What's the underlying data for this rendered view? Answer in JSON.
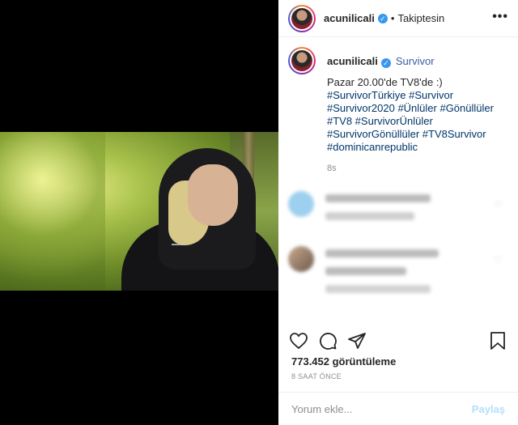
{
  "post": {
    "username": "acunilicali",
    "follow_state": "Takiptesin",
    "location": "Survivor",
    "caption_text": "Pazar 20.00'de TV8'de :)",
    "hashtags": "#SurvivorTürkiye #Survivor #Survivor2020 #Ünlüler #Gönüllüler #TV8 #SurvivorÜnlüler #SurvivorGönüllüler #TV8Survivor #dominicanrepublic",
    "caption_time": "8s",
    "views": "773.452 görüntüleme",
    "posted_ago": "8 SAAT ÖNCE",
    "comment_placeholder": "Yorum ekle...",
    "post_button": "Paylaş"
  },
  "icons": {
    "more": "more-options-icon",
    "verified": "verified-badge-icon",
    "like": "heart-icon",
    "comment": "comment-icon",
    "share": "share-icon",
    "save": "bookmark-icon"
  },
  "colors": {
    "verified": "#3897f0",
    "hashtag": "#003569",
    "post_button": "#b2dffc",
    "muted": "#8e8e8e"
  }
}
